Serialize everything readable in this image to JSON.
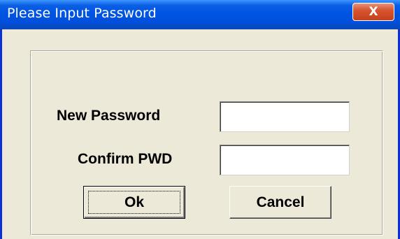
{
  "window": {
    "title": "Please Input Password",
    "close_glyph": "X"
  },
  "form": {
    "new_password_label": "New Password",
    "confirm_label": "Confirm PWD",
    "new_password_value": "",
    "confirm_value": ""
  },
  "buttons": {
    "ok_label": "Ok",
    "cancel_label": "Cancel"
  },
  "colors": {
    "titlebar": "#0054e3",
    "window_background": "#ece9d8",
    "close_button": "#d7542f"
  }
}
